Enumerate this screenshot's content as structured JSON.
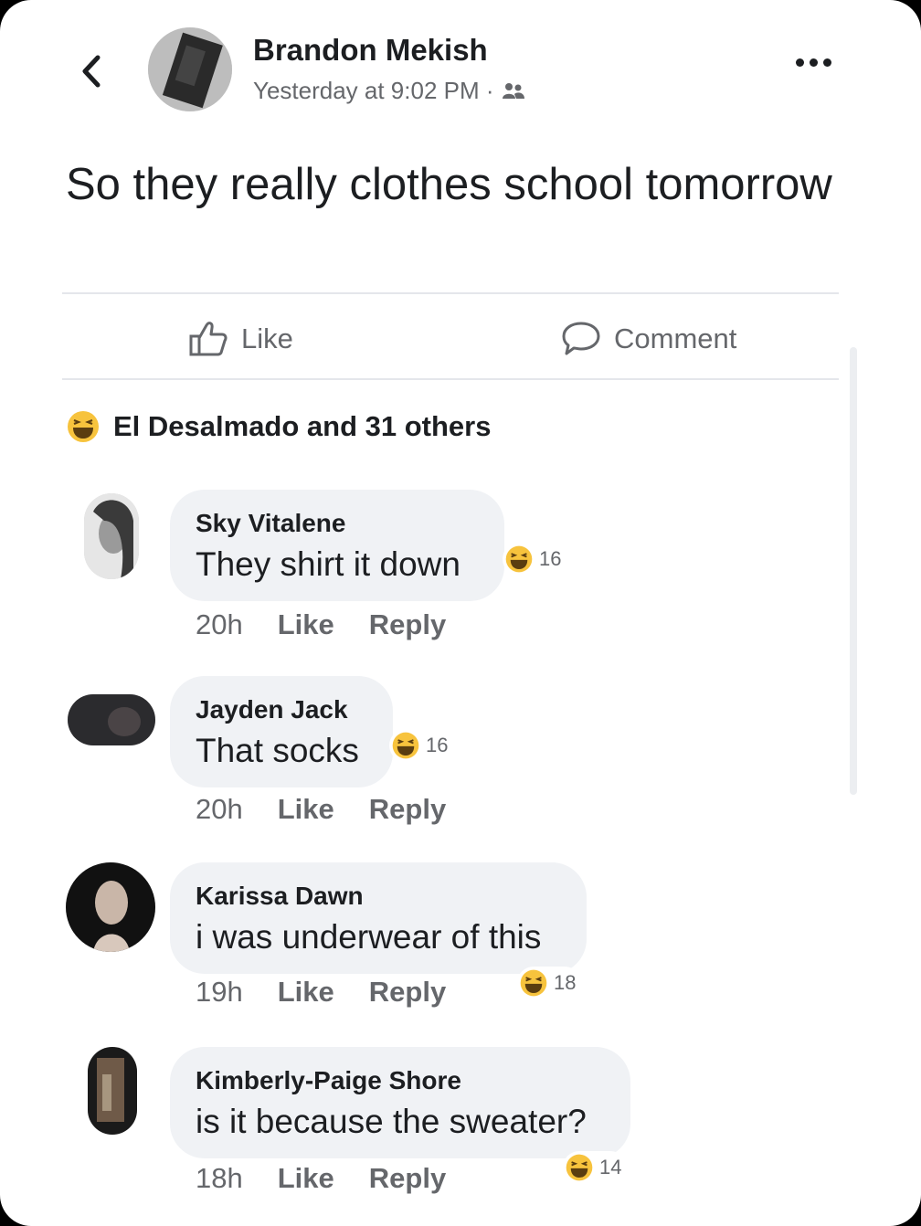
{
  "post": {
    "author": "Brandon Mekish",
    "timestamp": "Yesterday at 9:02 PM ·",
    "audience_icon": "friends-icon",
    "text": "So they really clothes school tomorrow"
  },
  "actions": {
    "like_label": "Like",
    "comment_label": "Comment"
  },
  "reactions_summary": {
    "icon": "haha-emoji-icon",
    "text": "El Desalmado and 31 others"
  },
  "comments": [
    {
      "name": "Sky Vitalene",
      "text": "They shirt it down",
      "reactions": "16",
      "time": "20h",
      "like": "Like",
      "reply": "Reply"
    },
    {
      "name": "Jayden Jack",
      "text": "That socks",
      "reactions": "16",
      "time": "20h",
      "like": "Like",
      "reply": "Reply"
    },
    {
      "name": "Karissa Dawn",
      "text": "i was underwear of this",
      "reactions": "18",
      "time": "19h",
      "like": "Like",
      "reply": "Reply"
    },
    {
      "name": "Kimberly-Paige Shore",
      "text": "is it because the sweater?",
      "reactions": "14",
      "time": "18h",
      "like": "Like",
      "reply": "Reply"
    }
  ],
  "colors": {
    "bubble": "#f0f2f5",
    "secondary_text": "#65676b",
    "primary_text": "#1c1e21",
    "haha_yellow": "#f7c33d"
  }
}
